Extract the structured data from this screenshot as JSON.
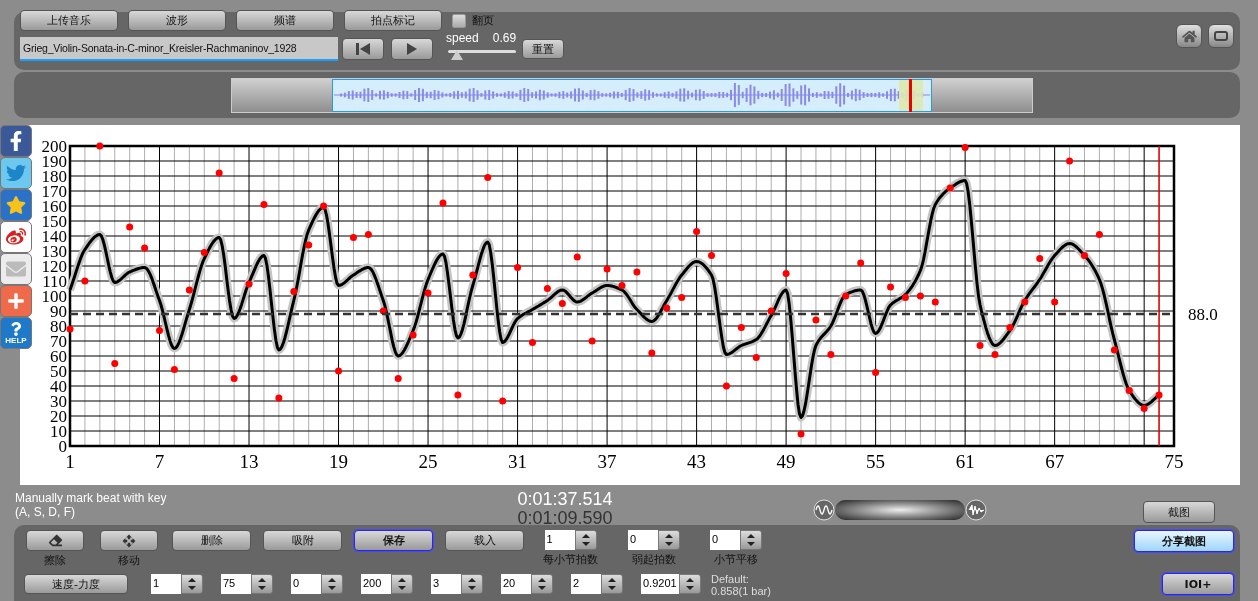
{
  "toolbar": {
    "buttons": [
      "上传音乐",
      "波形",
      "频谱",
      "拍点标记"
    ],
    "page_turn": {
      "label": "翻页",
      "checked": false
    },
    "filename": "Grieg_Violin-Sonata-in-C-minor_Kreisler-Rachmaninov_1928",
    "speed": {
      "label": "speed",
      "reading": "0.69",
      "level": 0.07
    },
    "reset_button": "重置"
  },
  "share_sidebar": {
    "help_label": "HELP"
  },
  "chart": {
    "chart_data": {
      "type": "line",
      "x": [
        1,
        2,
        3,
        4,
        5,
        6,
        7,
        8,
        9,
        10,
        11,
        12,
        13,
        14,
        15,
        16,
        17,
        18,
        19,
        20,
        21,
        22,
        23,
        24,
        25,
        26,
        27,
        28,
        29,
        30,
        31,
        32,
        33,
        34,
        35,
        36,
        37,
        38,
        39,
        40,
        41,
        42,
        43,
        44,
        45,
        46,
        47,
        48,
        49,
        50,
        51,
        52,
        53,
        54,
        55,
        56,
        57,
        58,
        59,
        60,
        61,
        62,
        63,
        64,
        65,
        66,
        67,
        68,
        69,
        70,
        71,
        72,
        73,
        74
      ],
      "series": [
        {
          "type": "line",
          "color": "#000000",
          "values": [
            104,
            131,
            141,
            109,
            116,
            119,
            97,
            65,
            91,
            125,
            139,
            85,
            109,
            127,
            64,
            97,
            144,
            159,
            107,
            114,
            119,
            97,
            60,
            77,
            111,
            128,
            72,
            107,
            136,
            69,
            85,
            91,
            97,
            104,
            96,
            102,
            107,
            104,
            91,
            83,
            97,
            114,
            123,
            114,
            61,
            67,
            71,
            87,
            104,
            19,
            67,
            80,
            101,
            104,
            75,
            94,
            101,
            117,
            161,
            172,
            177,
            94,
            67,
            77,
            97,
            111,
            127,
            135,
            127,
            111,
            71,
            37,
            27,
            34
          ]
        },
        {
          "type": "scatter",
          "color": "#ff0000",
          "values": [
            78,
            110,
            200,
            55,
            146,
            132,
            77,
            51,
            104,
            129,
            182,
            45,
            108,
            161,
            32,
            103,
            134,
            160,
            50,
            139,
            141,
            90,
            45,
            74,
            102,
            162,
            34,
            114,
            179,
            30,
            119,
            69,
            105,
            95,
            126,
            70,
            118,
            107,
            116,
            62,
            92,
            99,
            143,
            127,
            40,
            79,
            59,
            90,
            115,
            8,
            84,
            61,
            100,
            122,
            49,
            106,
            99,
            100,
            96,
            172,
            199,
            67,
            61,
            79,
            96,
            125,
            96,
            190,
            127,
            141,
            64,
            37,
            25,
            34
          ]
        }
      ],
      "xlim": [
        1,
        75
      ],
      "ylim": [
        0,
        200
      ],
      "xticks": [
        1,
        7,
        13,
        19,
        25,
        31,
        37,
        43,
        49,
        55,
        61,
        67,
        75
      ],
      "yticks": [
        0,
        10,
        20,
        30,
        40,
        50,
        60,
        70,
        80,
        90,
        100,
        110,
        120,
        130,
        140,
        150,
        160,
        170,
        180,
        190,
        200
      ],
      "grid": true,
      "ref_lines": [
        {
          "axis": "y",
          "value": 88,
          "label": "88.0"
        },
        {
          "axis": "x",
          "value": 74,
          "color": "#ee0000"
        }
      ]
    }
  },
  "status": {
    "hint": "Manually mark beat with key",
    "keys": "(A, S, D, F)",
    "time_current": "0:01:37.514",
    "time_total": "0:01:09.590",
    "screenshot_button": "截图"
  },
  "controls": {
    "tools": [
      {
        "kind": "eraser",
        "label": "擦除"
      },
      {
        "kind": "move",
        "label": "移动"
      }
    ],
    "buttons": [
      {
        "label": "删除",
        "focused": false
      },
      {
        "label": "吸附",
        "focused": false
      },
      {
        "label": "保存",
        "focused": true
      },
      {
        "label": "载入",
        "focused": false
      }
    ],
    "spinners": [
      {
        "value": "1",
        "label": "每小节拍数"
      },
      {
        "value": "0",
        "label": "弱起拍数"
      },
      {
        "value": "0",
        "label": "小节平移"
      }
    ],
    "share_button": {
      "label": "分享截图",
      "highlighted": true
    },
    "tempo_button": "速度-力度",
    "params": [
      "1",
      "75",
      "0",
      "200",
      "3",
      "20",
      "2",
      "0.9201"
    ],
    "default_note": "Default:",
    "default_value": "0.858(1 bar)",
    "ioi_button": {
      "label": "IOI+",
      "focused": true
    }
  }
}
